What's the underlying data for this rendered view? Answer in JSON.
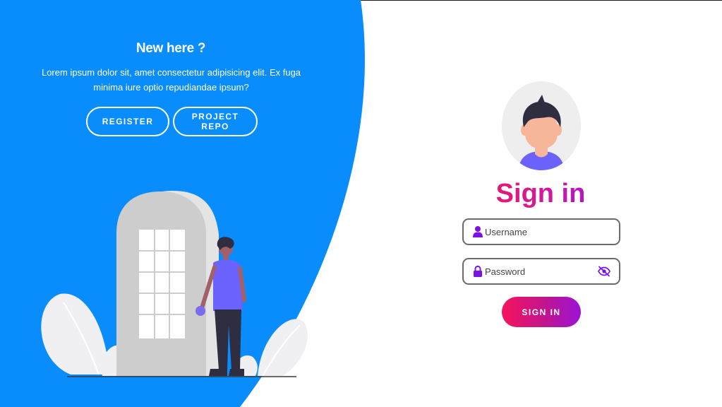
{
  "left_panel": {
    "title": "New here ?",
    "text": "Lorem ipsum dolor sit, amet consectetur adipisicing elit. Ex fuga minima iure optio repudiandae ipsum?",
    "buttons": {
      "register": "REGISTER",
      "project_repo": "PROJECT REPO"
    }
  },
  "form": {
    "title": "Sign in",
    "username": {
      "placeholder": "Username",
      "value": ""
    },
    "password": {
      "placeholder": "Password",
      "value": ""
    },
    "submit": "SIGN IN"
  },
  "icons": {
    "username": "user-icon",
    "password": "lock-icon",
    "toggle": "eye-slash-icon"
  },
  "colors": {
    "panel_blue": "#0a8dfc",
    "accent_pink": "#f0185c",
    "accent_purple": "#a314d6",
    "icon_purple": "#7a12e3"
  }
}
